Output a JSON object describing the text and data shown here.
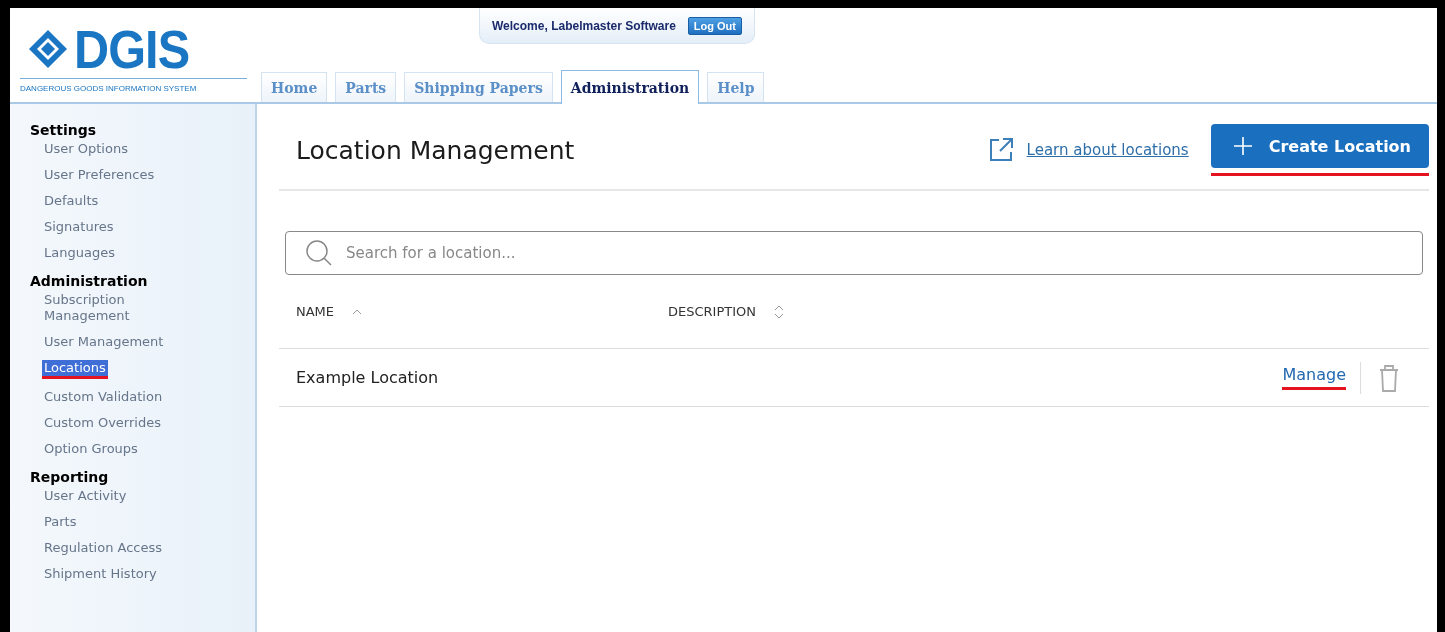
{
  "logo": {
    "name": "DGIS",
    "tagline": "DANGEROUS GOODS INFORMATION SYSTEM"
  },
  "welcome": "Welcome, Labelmaster Software",
  "logout_button": "Log Out",
  "tabs": [
    {
      "label": "Home",
      "selected": false
    },
    {
      "label": "Parts",
      "selected": false
    },
    {
      "label": "Shipping Papers",
      "selected": false
    },
    {
      "label": "Administration",
      "selected": true
    },
    {
      "label": "Help",
      "selected": false
    }
  ],
  "sidebar": {
    "sections": [
      {
        "title": "Settings",
        "items": [
          {
            "label": "User Options",
            "selected": false,
            "annotated": false
          },
          {
            "label": "User Preferences",
            "selected": false,
            "annotated": false
          },
          {
            "label": "Defaults",
            "selected": false,
            "annotated": false
          },
          {
            "label": "Signatures",
            "selected": false,
            "annotated": false
          },
          {
            "label": "Languages",
            "selected": false,
            "annotated": false
          }
        ]
      },
      {
        "title": "Administration",
        "items": [
          {
            "label": "Subscription Management",
            "selected": false,
            "annotated": false
          },
          {
            "label": "User Management",
            "selected": false,
            "annotated": false
          },
          {
            "label": "Locations",
            "selected": true,
            "annotated": true
          },
          {
            "label": "Custom Validation",
            "selected": false,
            "annotated": false
          },
          {
            "label": "Custom Overrides",
            "selected": false,
            "annotated": false
          },
          {
            "label": "Option Groups",
            "selected": false,
            "annotated": false
          }
        ]
      },
      {
        "title": "Reporting",
        "items": [
          {
            "label": "User Activity",
            "selected": false,
            "annotated": false
          },
          {
            "label": "Parts",
            "selected": false,
            "annotated": false
          },
          {
            "label": "Regulation Access",
            "selected": false,
            "annotated": false
          },
          {
            "label": "Shipment History",
            "selected": false,
            "annotated": false
          }
        ]
      }
    ]
  },
  "page": {
    "title": "Location Management",
    "help_link": "Learn about locations",
    "create_button": {
      "label": "Create Location",
      "annotated": true
    },
    "search": {
      "placeholder": "Search for a location..."
    },
    "table": {
      "columns": [
        {
          "label": "NAME",
          "sorted": true
        },
        {
          "label": "DESCRIPTION",
          "sorted": false
        }
      ],
      "rows": [
        {
          "name": "Example Location",
          "action": "Manage",
          "action_annotated": true
        }
      ]
    }
  }
}
